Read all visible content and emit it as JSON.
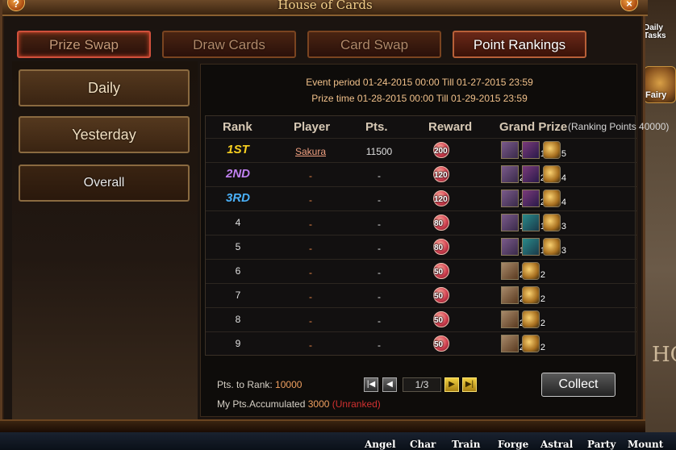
{
  "window": {
    "title": "House of Cards"
  },
  "tabs": [
    {
      "label": "Prize Swap"
    },
    {
      "label": "Draw Cards"
    },
    {
      "label": "Card Swap"
    },
    {
      "label": "Point Rankings"
    }
  ],
  "sidebar": [
    {
      "label": "Daily"
    },
    {
      "label": "Yesterday"
    },
    {
      "label": "Overall"
    }
  ],
  "event": {
    "period": "Event period 01-24-2015 00:00 Till 01-27-2015 23:59",
    "prize_time": "Prize time 01-28-2015 00:00 Till 01-29-2015 23:59"
  },
  "table": {
    "headers": {
      "rank": "Rank",
      "player": "Player",
      "pts": "Pts.",
      "reward": "Reward",
      "grand_prize": "Grand Prize"
    },
    "ranking_note": "(Ranking Points 40000)",
    "rows": [
      {
        "rank": "1ST",
        "rank_color": "#f8d020",
        "player": "Sakura",
        "pts": "11500",
        "reward": "200",
        "prizes": [
          {
            "type": "scroll",
            "count": "3"
          },
          {
            "type": "potion",
            "count": "1"
          },
          {
            "type": "moon",
            "count": "5"
          }
        ]
      },
      {
        "rank": "2ND",
        "rank_color": "#c080f0",
        "player": "-",
        "pts": "-",
        "reward": "120",
        "prizes": [
          {
            "type": "scroll",
            "count": "2"
          },
          {
            "type": "potion",
            "count": "2"
          },
          {
            "type": "moon",
            "count": "4"
          }
        ]
      },
      {
        "rank": "3RD",
        "rank_color": "#4ab0f8",
        "player": "-",
        "pts": "-",
        "reward": "120",
        "prizes": [
          {
            "type": "scroll",
            "count": "2"
          },
          {
            "type": "potion",
            "count": "2"
          },
          {
            "type": "moon",
            "count": "4"
          }
        ]
      },
      {
        "rank": "4",
        "player": "-",
        "pts": "-",
        "reward": "80",
        "prizes": [
          {
            "type": "scroll",
            "count": "1"
          },
          {
            "type": "potion-teal",
            "count": "1"
          },
          {
            "type": "moon",
            "count": "3"
          }
        ]
      },
      {
        "rank": "5",
        "player": "-",
        "pts": "-",
        "reward": "80",
        "prizes": [
          {
            "type": "scroll",
            "count": "1"
          },
          {
            "type": "potion-teal",
            "count": "1"
          },
          {
            "type": "moon",
            "count": "3"
          }
        ]
      },
      {
        "rank": "6",
        "player": "-",
        "pts": "-",
        "reward": "50",
        "prizes": [
          {
            "type": "chest",
            "count": "2"
          },
          {
            "type": "moon",
            "count": "2"
          }
        ]
      },
      {
        "rank": "7",
        "player": "-",
        "pts": "-",
        "reward": "50",
        "prizes": [
          {
            "type": "chest",
            "count": "2"
          },
          {
            "type": "moon",
            "count": "2"
          }
        ]
      },
      {
        "rank": "8",
        "player": "-",
        "pts": "-",
        "reward": "50",
        "prizes": [
          {
            "type": "chest",
            "count": "2"
          },
          {
            "type": "moon",
            "count": "2"
          }
        ]
      },
      {
        "rank": "9",
        "player": "-",
        "pts": "-",
        "reward": "50",
        "prizes": [
          {
            "type": "chest",
            "count": "2"
          },
          {
            "type": "moon",
            "count": "2"
          }
        ]
      }
    ]
  },
  "footer": {
    "pts_to_rank_label": "Pts. to Rank:",
    "pts_to_rank_value": "10000",
    "accumulated_label": "My Pts.Accumulated",
    "accumulated_value": "3000",
    "unranked": "(Unranked)",
    "page": "1/3",
    "collect_label": "Collect"
  },
  "side_right": {
    "daily_tasks": "Daily Tasks",
    "fairy": "Fairy",
    "scene_text": "HO"
  },
  "bottom_menu": [
    "Angel",
    "Char",
    "Train",
    "Forge",
    "Astral",
    "Party",
    "Mount"
  ]
}
